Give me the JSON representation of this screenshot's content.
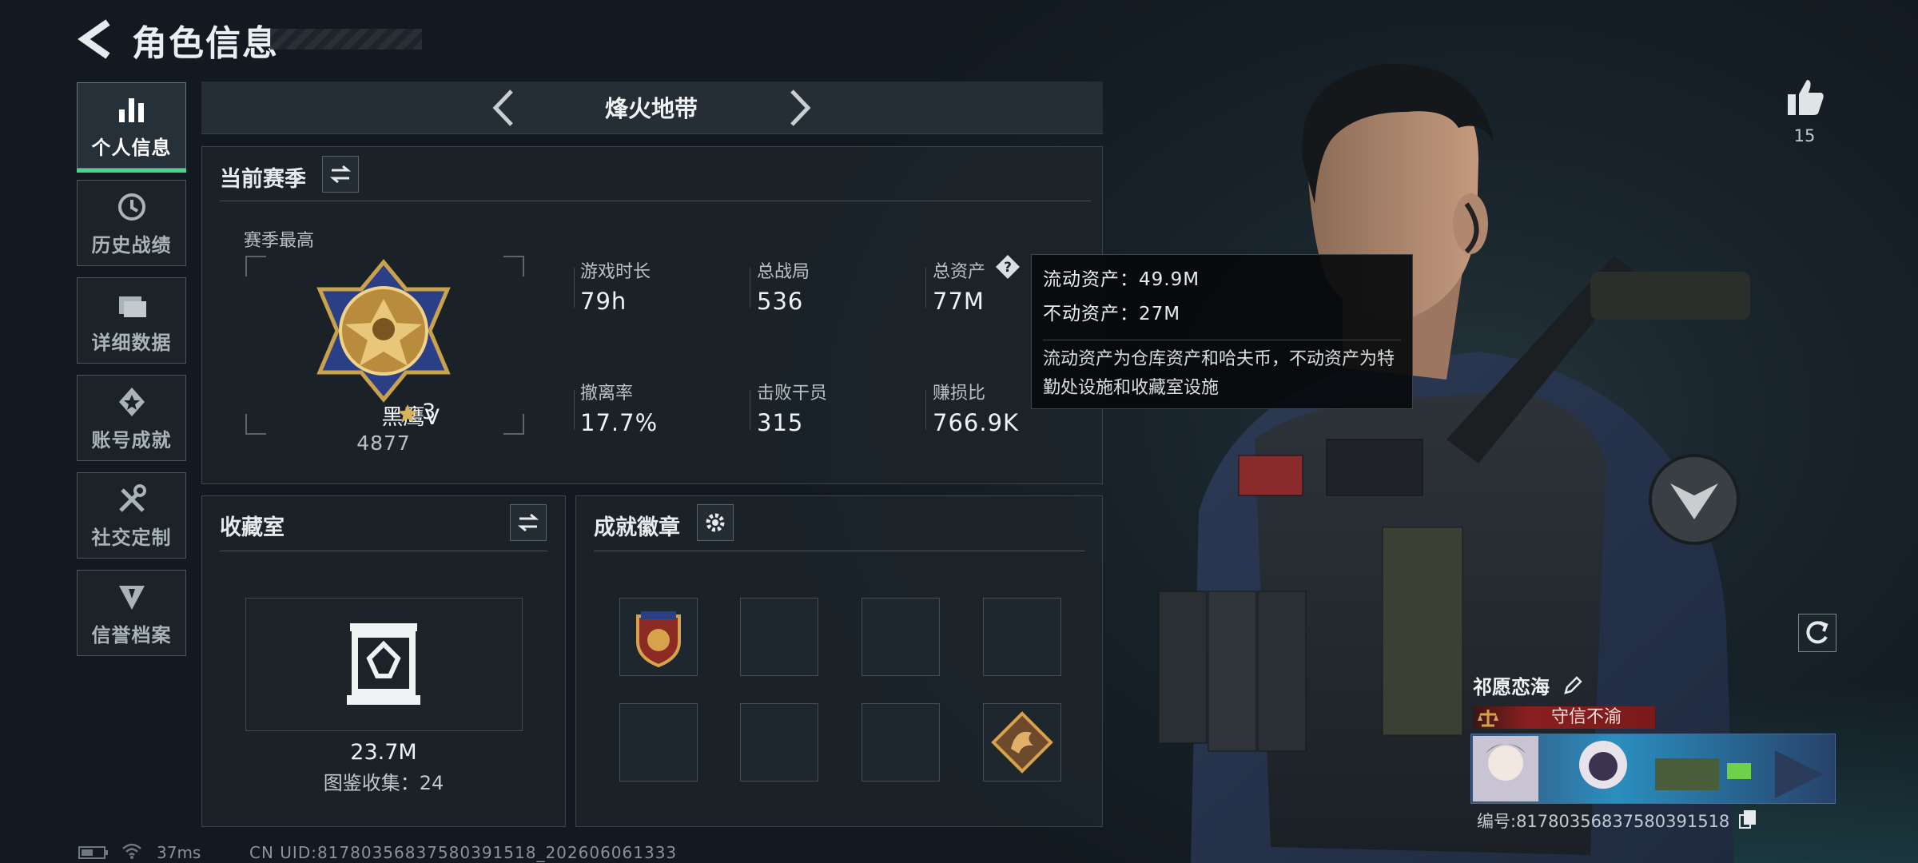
{
  "header": {
    "title": "角色信息"
  },
  "nav": [
    {
      "label": "个人信息",
      "icon": "bar-chart-icon",
      "active": true
    },
    {
      "label": "历史战绩",
      "icon": "history-clock-icon",
      "active": false
    },
    {
      "label": "详细数据",
      "icon": "folder-icon",
      "active": false
    },
    {
      "label": "账号成就",
      "icon": "achievement-star-icon",
      "active": false
    },
    {
      "label": "社交定制",
      "icon": "tools-icon",
      "active": false
    },
    {
      "label": "信誉档案",
      "icon": "reputation-shield-icon",
      "active": false
    }
  ],
  "mode_selector": {
    "label": "烽火地带"
  },
  "season": {
    "title": "当前赛季",
    "best_label": "赛季最高",
    "rank_name": "黑鹰V",
    "rank_stars": "3",
    "rank_score": "4877",
    "stats": [
      {
        "label": "游戏时长",
        "value": "79h"
      },
      {
        "label": "总战局",
        "value": "536"
      },
      {
        "label": "总资产",
        "value": "77M"
      },
      {
        "label": "撤离率",
        "value": "17.7%"
      },
      {
        "label": "击败干员",
        "value": "315"
      },
      {
        "label": "赚损比",
        "value": "766.9K"
      }
    ]
  },
  "tooltip": {
    "line1": "流动资产：49.9M",
    "line2": "不动资产：27M",
    "desc": "流动资产为仓库资产和哈夫币，不动资产为特勤处设施和收藏室设施"
  },
  "collection": {
    "title": "收藏室",
    "value": "23.7M",
    "sub": "图鉴收集：24"
  },
  "badges": {
    "title": "成就徽章"
  },
  "likes": {
    "count": "15"
  },
  "player": {
    "name": "祁愿恋海",
    "title_tag": "守信不渝",
    "id_text": "编号:81780356837580391518"
  },
  "footer": {
    "ping": "37ms",
    "uid": "CN UID:81780356837580391518_202606061333"
  },
  "colors": {
    "accent_green": "#3ddc84",
    "tag_red": "#8a1f1f"
  }
}
